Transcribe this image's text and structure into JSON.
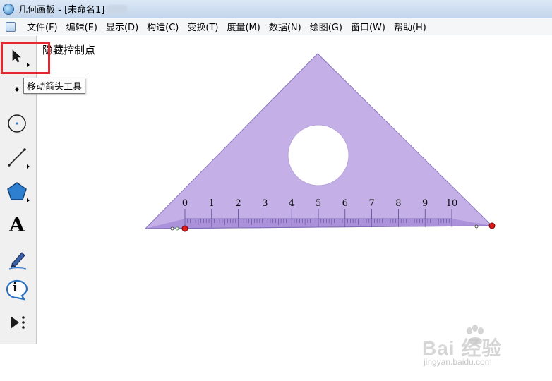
{
  "window": {
    "title": "几何画板 - [未命名1]"
  },
  "menu": [
    "文件(F)",
    "编辑(E)",
    "显示(D)",
    "构造(C)",
    "变换(T)",
    "度量(M)",
    "数据(N)",
    "绘图(G)",
    "窗口(W)",
    "帮助(H)"
  ],
  "tools": [
    {
      "name": "move-arrow",
      "icon": "arrow-cursor-icon"
    },
    {
      "name": "point",
      "icon": "point-icon"
    },
    {
      "name": "compass",
      "icon": "compass-circle-icon"
    },
    {
      "name": "straightedge",
      "icon": "line-segment-icon"
    },
    {
      "name": "polygon",
      "icon": "polygon-icon"
    },
    {
      "name": "text",
      "icon": "text-a-icon",
      "glyph": "A"
    },
    {
      "name": "marker",
      "icon": "marker-pen-icon"
    },
    {
      "name": "information",
      "icon": "info-icon",
      "glyph": "i"
    },
    {
      "name": "custom",
      "icon": "play-more-icon"
    }
  ],
  "tooltip": "移动箭头工具",
  "canvas": {
    "hide_control_points": "隐藏控制点",
    "ruler_labels": [
      "0",
      "1",
      "2",
      "3",
      "4",
      "5",
      "6",
      "7",
      "8",
      "9",
      "10"
    ]
  },
  "colors": {
    "triangle_fill": "#c4b0e6",
    "triangle_stroke": "#8a78c2",
    "ruler_band": "#ab92db",
    "control_point": "#dd1c1c",
    "highlight": "#e3262f"
  },
  "watermark": {
    "brand": "Bai 经验",
    "url": "jingyan.baidu.com"
  }
}
